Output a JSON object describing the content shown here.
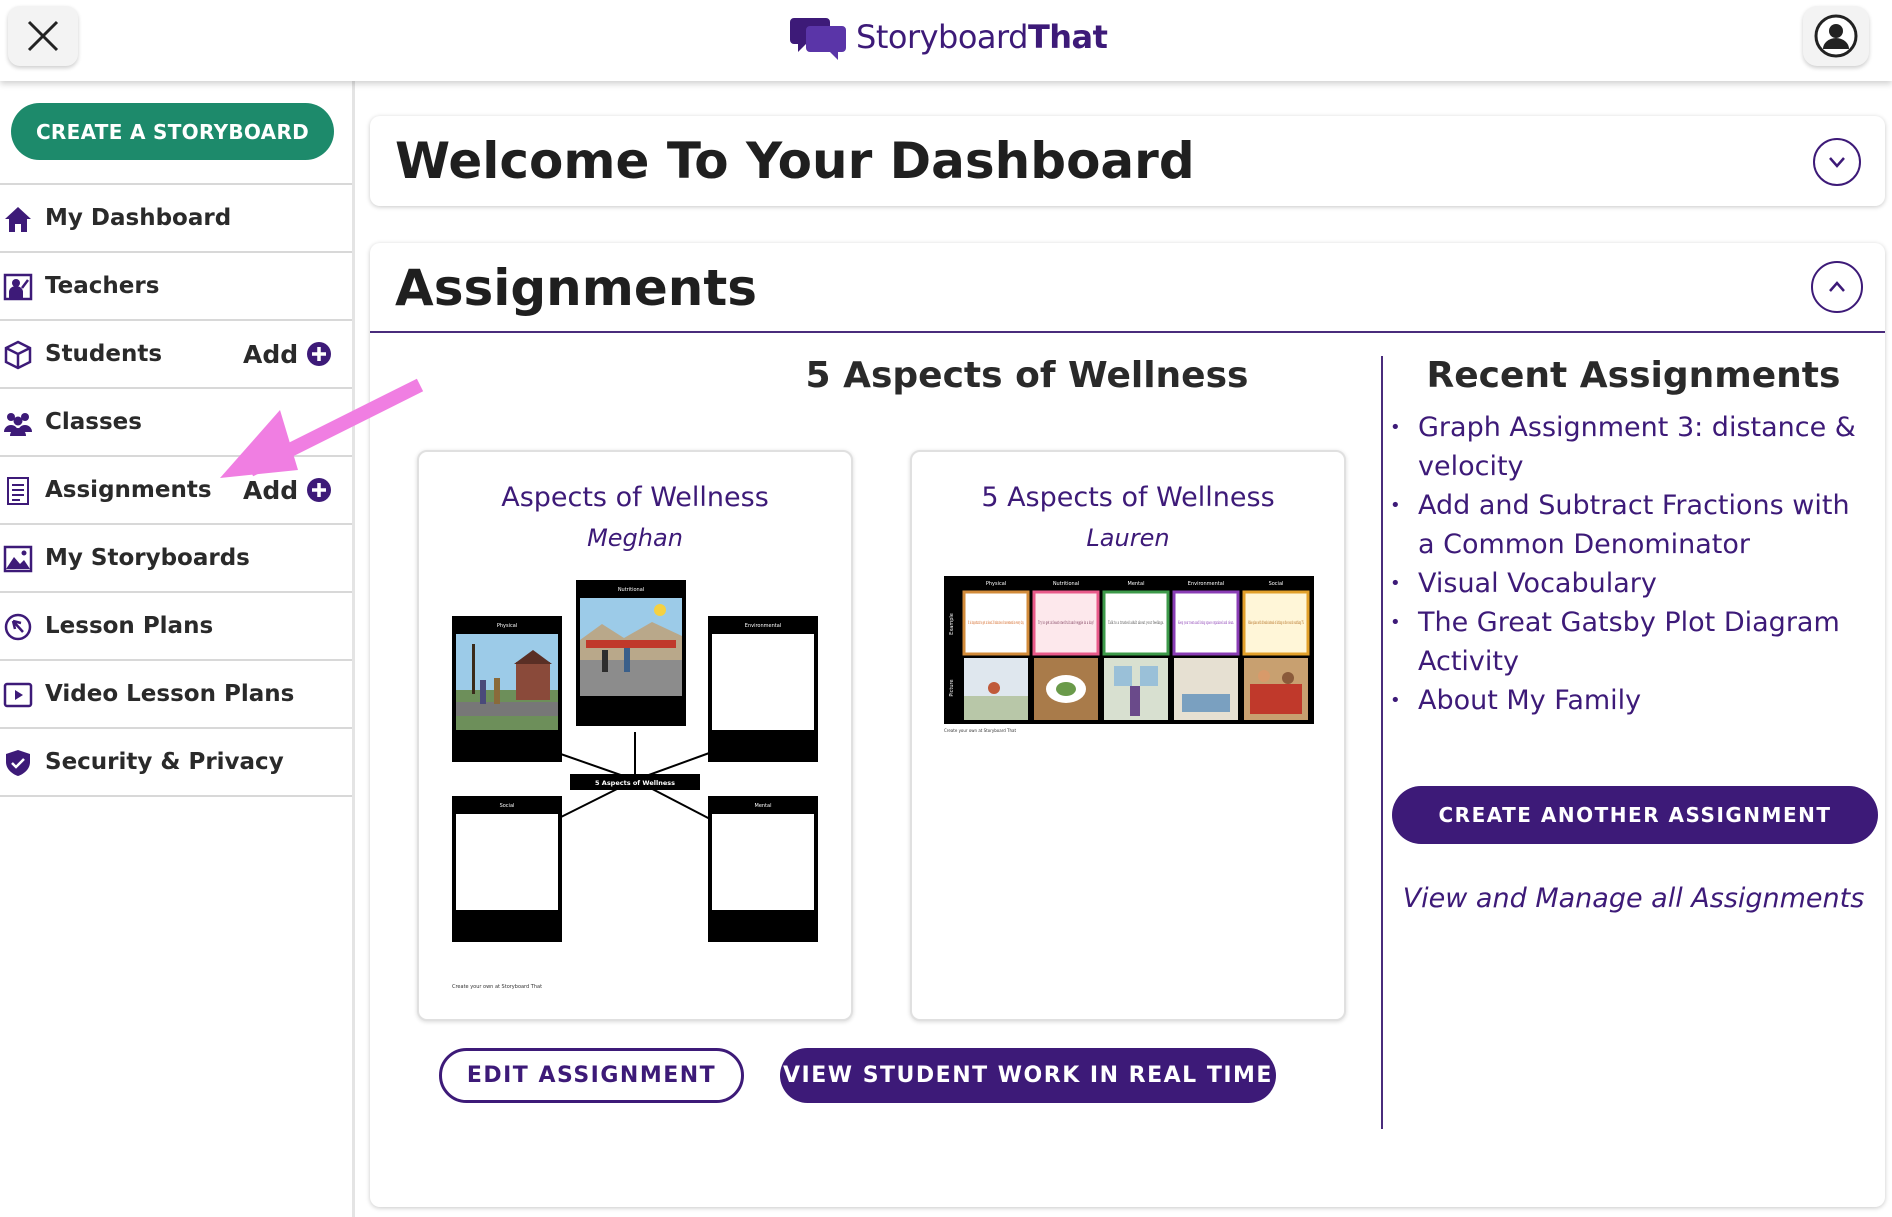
{
  "header": {
    "logo_text_regular": "Storyboard",
    "logo_text_bold": "That"
  },
  "sidebar": {
    "create_button": "CREATE A STORYBOARD",
    "items": [
      {
        "label": "My Dashboard",
        "icon": "home-icon"
      },
      {
        "label": "Teachers",
        "icon": "teacher-icon"
      },
      {
        "label": "Students",
        "icon": "students-icon",
        "add": "Add"
      },
      {
        "label": "Classes",
        "icon": "classes-icon"
      },
      {
        "label": "Assignments",
        "icon": "assignments-icon",
        "add": "Add"
      },
      {
        "label": "My Storyboards",
        "icon": "image-icon"
      },
      {
        "label": "Lesson Plans",
        "icon": "lesson-plans-icon"
      },
      {
        "label": "Video Lesson Plans",
        "icon": "video-icon"
      },
      {
        "label": "Security & Privacy",
        "icon": "shield-icon"
      }
    ]
  },
  "welcome": {
    "title": "Welcome To Your Dashboard"
  },
  "assignments": {
    "title": "Assignments",
    "featured_title": "5 Aspects of Wellness",
    "storyboards": [
      {
        "title": "Aspects of Wellness",
        "author": "Meghan"
      },
      {
        "title": "5 Aspects of Wellness",
        "author": "Lauren"
      }
    ],
    "edit_button": "EDIT ASSIGNMENT",
    "view_button": "VIEW STUDENT WORK IN REAL TIME"
  },
  "thumb1": {
    "center_label": "5 Aspects of Wellness",
    "cells": [
      "Nutritional",
      "Physical",
      "Environmental",
      "Social",
      "Mental"
    ],
    "footer": "Create your own at Storyboard That"
  },
  "thumb2": {
    "headers": [
      "Physical",
      "Nutritional",
      "Mental",
      "Environmental",
      "Social"
    ],
    "row_labels": [
      "Example",
      "Picture"
    ],
    "texts": [
      "It is important to get at least 20 minutes of movement in every day.",
      "Try to get at least one fruit and veggie in a day!",
      "Talk to a trusted adult about your feelings.",
      "Keep your room and living space organized and clean.",
      "Make plans with friends instead of sitting on the couch watching TV."
    ],
    "footer": "Create your own at Storyboard That"
  },
  "recent": {
    "title": "Recent Assignments",
    "items": [
      "Graph Assignment 3: distance & velocity",
      "Add and Subtract Fractions with a Common Denominator",
      "Visual Vocabulary",
      "The Great Gatsby Plot Diagram Activity",
      "About My Family"
    ],
    "create_button": "CREATE ANOTHER ASSIGNMENT",
    "view_all": "View and Manage all Assignments"
  },
  "colors": {
    "brand_purple": "#3d1a78",
    "brand_green": "#1d8a6b",
    "annotation_arrow": "#f07ee2"
  }
}
